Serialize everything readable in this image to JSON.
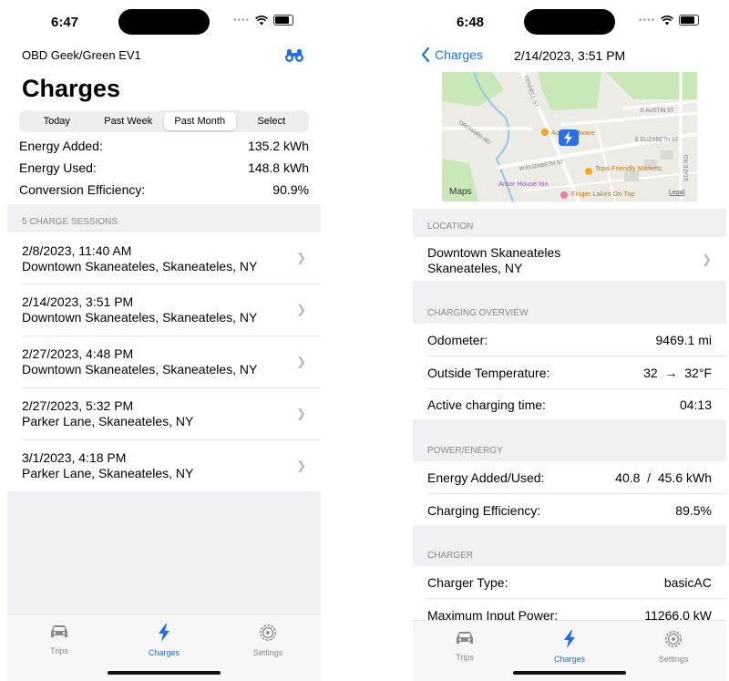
{
  "left": {
    "status_time": "6:47",
    "header_left": "OBD Geek/Green EV1",
    "title": "Charges",
    "segments": [
      "Today",
      "Past Week",
      "Past Month",
      "Select"
    ],
    "selected_segment": "Past Month",
    "summary": [
      {
        "label": "Energy Added:",
        "value": "135.2 kWh"
      },
      {
        "label": "Energy Used:",
        "value": "148.8 kWh"
      },
      {
        "label": "Conversion Efficiency:",
        "value": "90.9%"
      }
    ],
    "sessions_header": "5 CHARGE SESSIONS",
    "sessions": [
      {
        "date": "2/8/2023, 11:40 AM",
        "location": "Downtown Skaneateles, Skaneateles, NY"
      },
      {
        "date": "2/14/2023, 3:51 PM",
        "location": "Downtown Skaneateles, Skaneateles, NY"
      },
      {
        "date": "2/27/2023, 4:48 PM",
        "location": "Downtown Skaneateles, Skaneateles, NY"
      },
      {
        "date": "2/27/2023, 5:32 PM",
        "location": "Parker Lane, Skaneateles, NY"
      },
      {
        "date": "3/1/2023, 4:18 PM",
        "location": "Parker Lane, Skaneateles, NY"
      }
    ]
  },
  "right": {
    "status_time": "6:48",
    "back_label": "Charges",
    "nav_title": "2/14/2023, 3:51 PM",
    "map": {
      "streets": [
        "FENNELL ST",
        "E AUSTIN ST",
        "E ELIZABETH ST",
        "W ELIZABETH ST",
        "ORCHARD RD",
        "STATE RO"
      ],
      "places": [
        "Ace Hardware",
        "Tops Friendly Markets",
        "Arbor House Inn",
        "Finger Lakes On Tap"
      ],
      "brand": "Maps",
      "legal": "Legal"
    },
    "location_header": "LOCATION",
    "location_line1": "Downtown Skaneateles",
    "location_line2": "Skaneateles, NY",
    "overview_header": "CHARGING OVERVIEW",
    "overview": [
      {
        "label": "Odometer:",
        "value": "9469.1 mi"
      },
      {
        "label": "Outside Temperature:",
        "value": "32  →  32°F"
      },
      {
        "label": "Active charging time:",
        "value": "04:13"
      }
    ],
    "power_header": "POWER/ENERGY",
    "power": [
      {
        "label": "Energy Added/Used:",
        "value": "40.8  /  45.6 kWh"
      },
      {
        "label": "Charging Efficiency:",
        "value": "89.5%"
      }
    ],
    "charger_header": "CHARGER",
    "charger": [
      {
        "label": "Charger Type:",
        "value": "basicAC"
      },
      {
        "label": "Maximum Input Power:",
        "value": "11266.0 kW"
      }
    ]
  },
  "tabs": [
    {
      "label": "Trips",
      "icon": "car-icon"
    },
    {
      "label": "Charges",
      "icon": "bolt-icon"
    },
    {
      "label": "Settings",
      "icon": "gear-icon"
    }
  ],
  "active_tab": "Charges",
  "colors": {
    "accent": "#1f6fe6",
    "grouped_bg": "#efeff4"
  }
}
